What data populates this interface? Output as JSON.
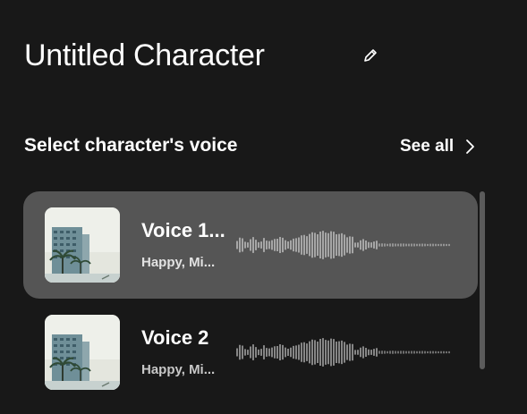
{
  "character": {
    "title": "Untitled Character",
    "edit_icon": "pencil-icon"
  },
  "voice_section": {
    "heading": "Select character's voice",
    "see_all_label": "See all",
    "see_all_icon": "chevron-right-icon"
  },
  "voices": [
    {
      "name": "Voice 1...",
      "tags": "Happy, Mi...",
      "selected": true,
      "thumbnail": "building-palm-thumbnail"
    },
    {
      "name": "Voice 2",
      "tags": "Happy, Mi...",
      "selected": false,
      "thumbnail": "building-palm-thumbnail"
    }
  ],
  "colors": {
    "background": "#181818",
    "selected_card": "#555555",
    "text": "#ffffff",
    "muted_text": "#c8c8c8",
    "scrollbar": "#5b5b5b"
  }
}
